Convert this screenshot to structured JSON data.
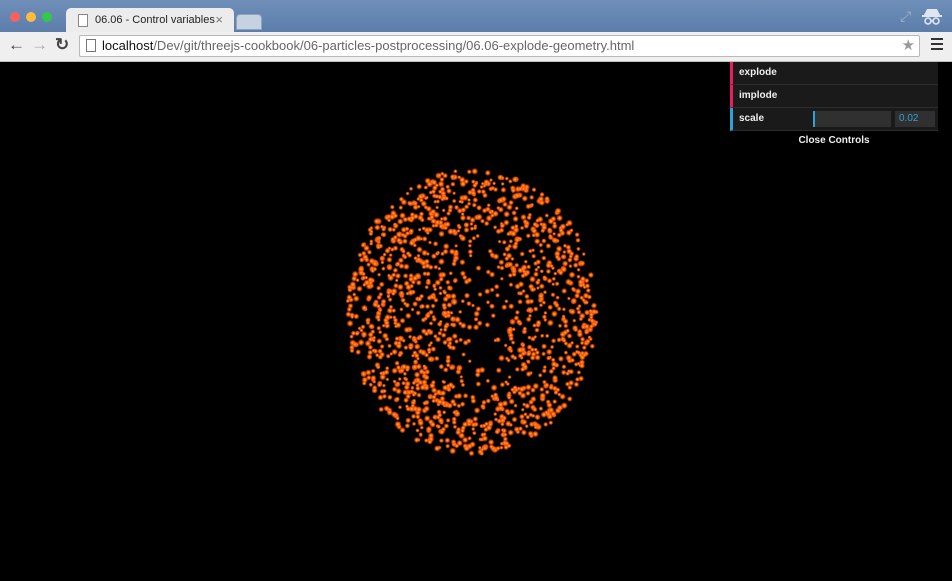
{
  "window": {
    "traffic_colors": [
      "#fc605c",
      "#fdbc40",
      "#34c84a"
    ]
  },
  "tab": {
    "title": "06.06 - Control variables",
    "close_glyph": "×"
  },
  "toolbar": {
    "back_glyph": "←",
    "forward_glyph": "→",
    "reload_glyph": "↻",
    "url_host": "localhost",
    "url_path": "/Dev/git/threejs-cookbook/06-particles-postprocessing/06.06-explode-geometry.html",
    "star_glyph": "★"
  },
  "gui": {
    "explode_label": "explode",
    "implode_label": "implode",
    "scale_label": "scale",
    "scale_value": "0.02",
    "scale_fraction": 0.02,
    "close_label": "Close Controls",
    "function_color": "#e61d5f",
    "number_color": "#2fa1d6"
  },
  "scene": {
    "particle_color": "#ff5a0a",
    "highlight_color": "#ffc040"
  }
}
